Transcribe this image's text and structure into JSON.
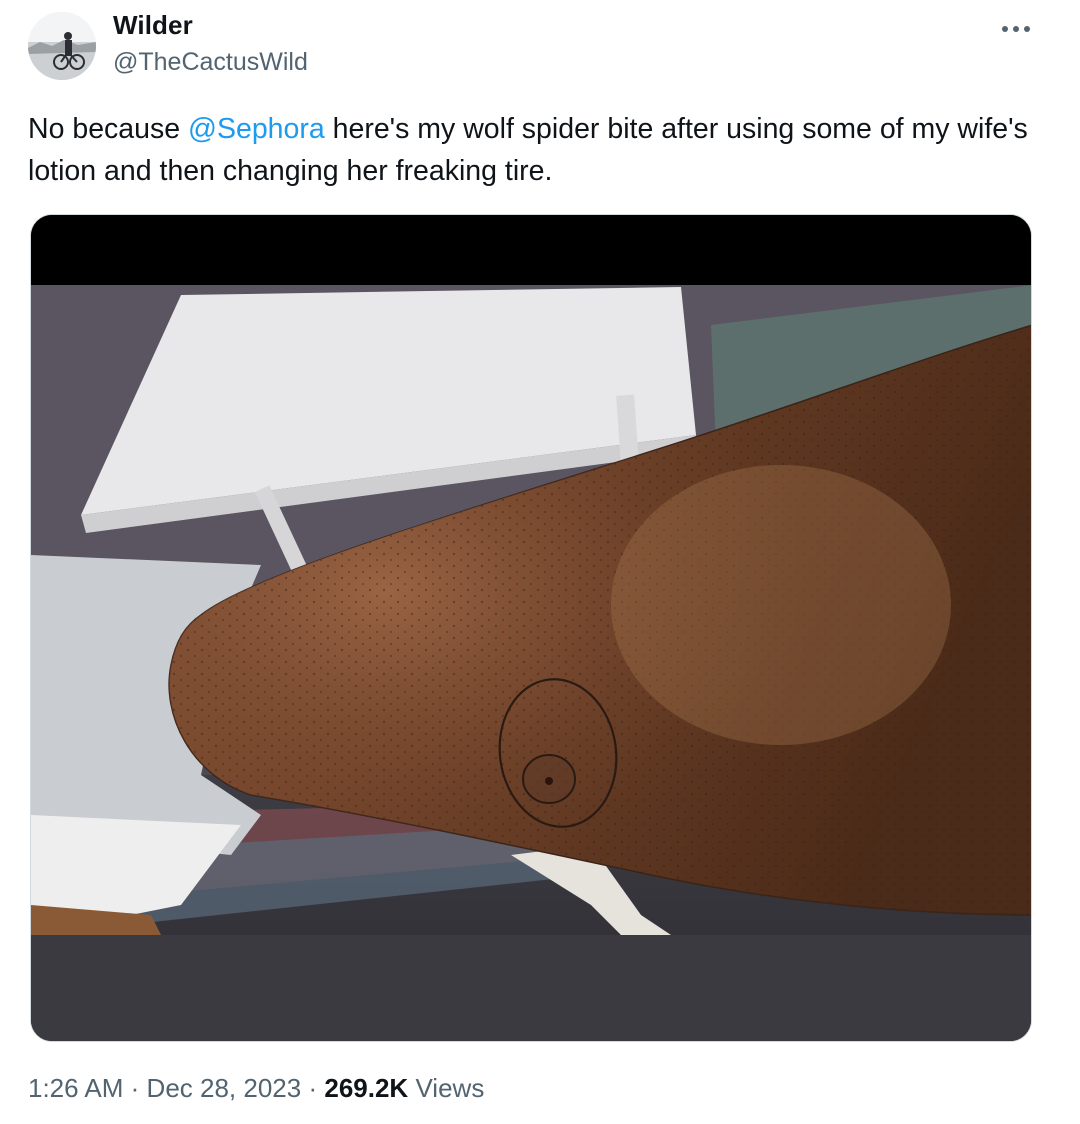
{
  "author": {
    "name": "Wilder",
    "handle": "@TheCactusWild"
  },
  "menu": {
    "icon": "more-horizontal-icon"
  },
  "tweet": {
    "text_before": "No because ",
    "mention": "@Sephora",
    "text_after": "  here's my wolf spider bite after using some of my wife's lotion and then changing her freaking tire."
  },
  "meta": {
    "time": "1:26 AM",
    "separator": "·",
    "date": "Dec 28, 2023",
    "views_count": "269.2K",
    "views_label": "Views"
  },
  "colors": {
    "link": "#1d9bf0",
    "secondary_text": "#536471",
    "primary_text": "#0f1419"
  }
}
